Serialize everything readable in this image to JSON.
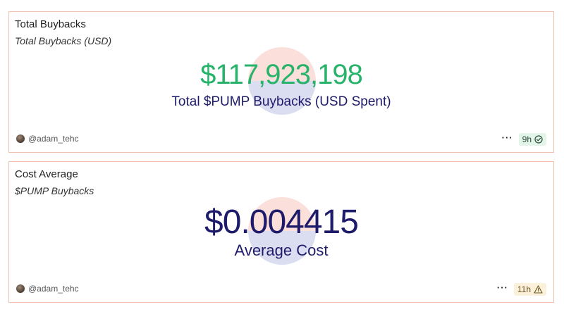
{
  "cards": [
    {
      "title": "Total Buybacks",
      "subtitle": "Total Buybacks (USD)",
      "value": "$117,923,198",
      "label": "Total $PUMP Buybacks (USD Spent)",
      "value_color": "#27b36a",
      "author": "@adam_tehc",
      "age": "9h",
      "status_icon": "check-circle-icon",
      "status": "fresh"
    },
    {
      "title": "Cost Average",
      "subtitle": "$PUMP Buybacks",
      "value": "$0.004415",
      "label": "Average Cost",
      "value_color": "#1e1b6b",
      "author": "@adam_tehc",
      "age": "11h",
      "status_icon": "warning-icon",
      "status": "stale"
    }
  ],
  "colors": {
    "card_border": "#f0c2ad",
    "label_navy": "#1e1b6b",
    "ok_badge_bg": "#e3f5e8",
    "warn_badge_bg": "#fbf0d9"
  }
}
